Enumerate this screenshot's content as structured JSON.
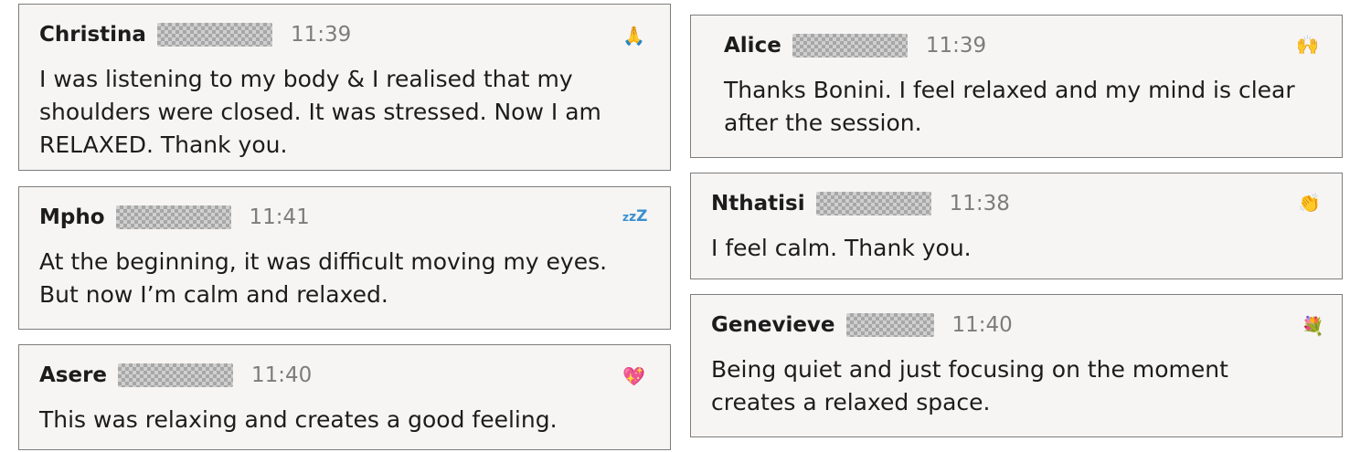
{
  "messages": [
    {
      "name": "Christina",
      "time": "11:39",
      "emoji": "🙏",
      "text": "I was listening to my body & I realised that my shoulders were closed. It was stressed. Now I am RELAXED. Thank you."
    },
    {
      "name": "Mpho",
      "time": "11:41",
      "emoji": "zzz-icon",
      "text": "At the beginning, it was difficult moving my eyes. But now I’m calm and relaxed."
    },
    {
      "name": "Asere",
      "time": "11:40",
      "emoji": "💖",
      "text": "This was relaxing and creates a good feeling."
    },
    {
      "name": "Alice",
      "time": "11:39",
      "emoji": "🙌",
      "text": "Thanks Bonini. I feel relaxed and my mind is clear after the session."
    },
    {
      "name": "Nthatisi",
      "time": "11:38",
      "emoji": "👏",
      "text": "I feel calm. Thank you."
    },
    {
      "name": "Genevieve",
      "time": "11:40",
      "emoji": "💐",
      "text": "Being quiet and just focusing on the moment creates a relaxed space."
    }
  ]
}
